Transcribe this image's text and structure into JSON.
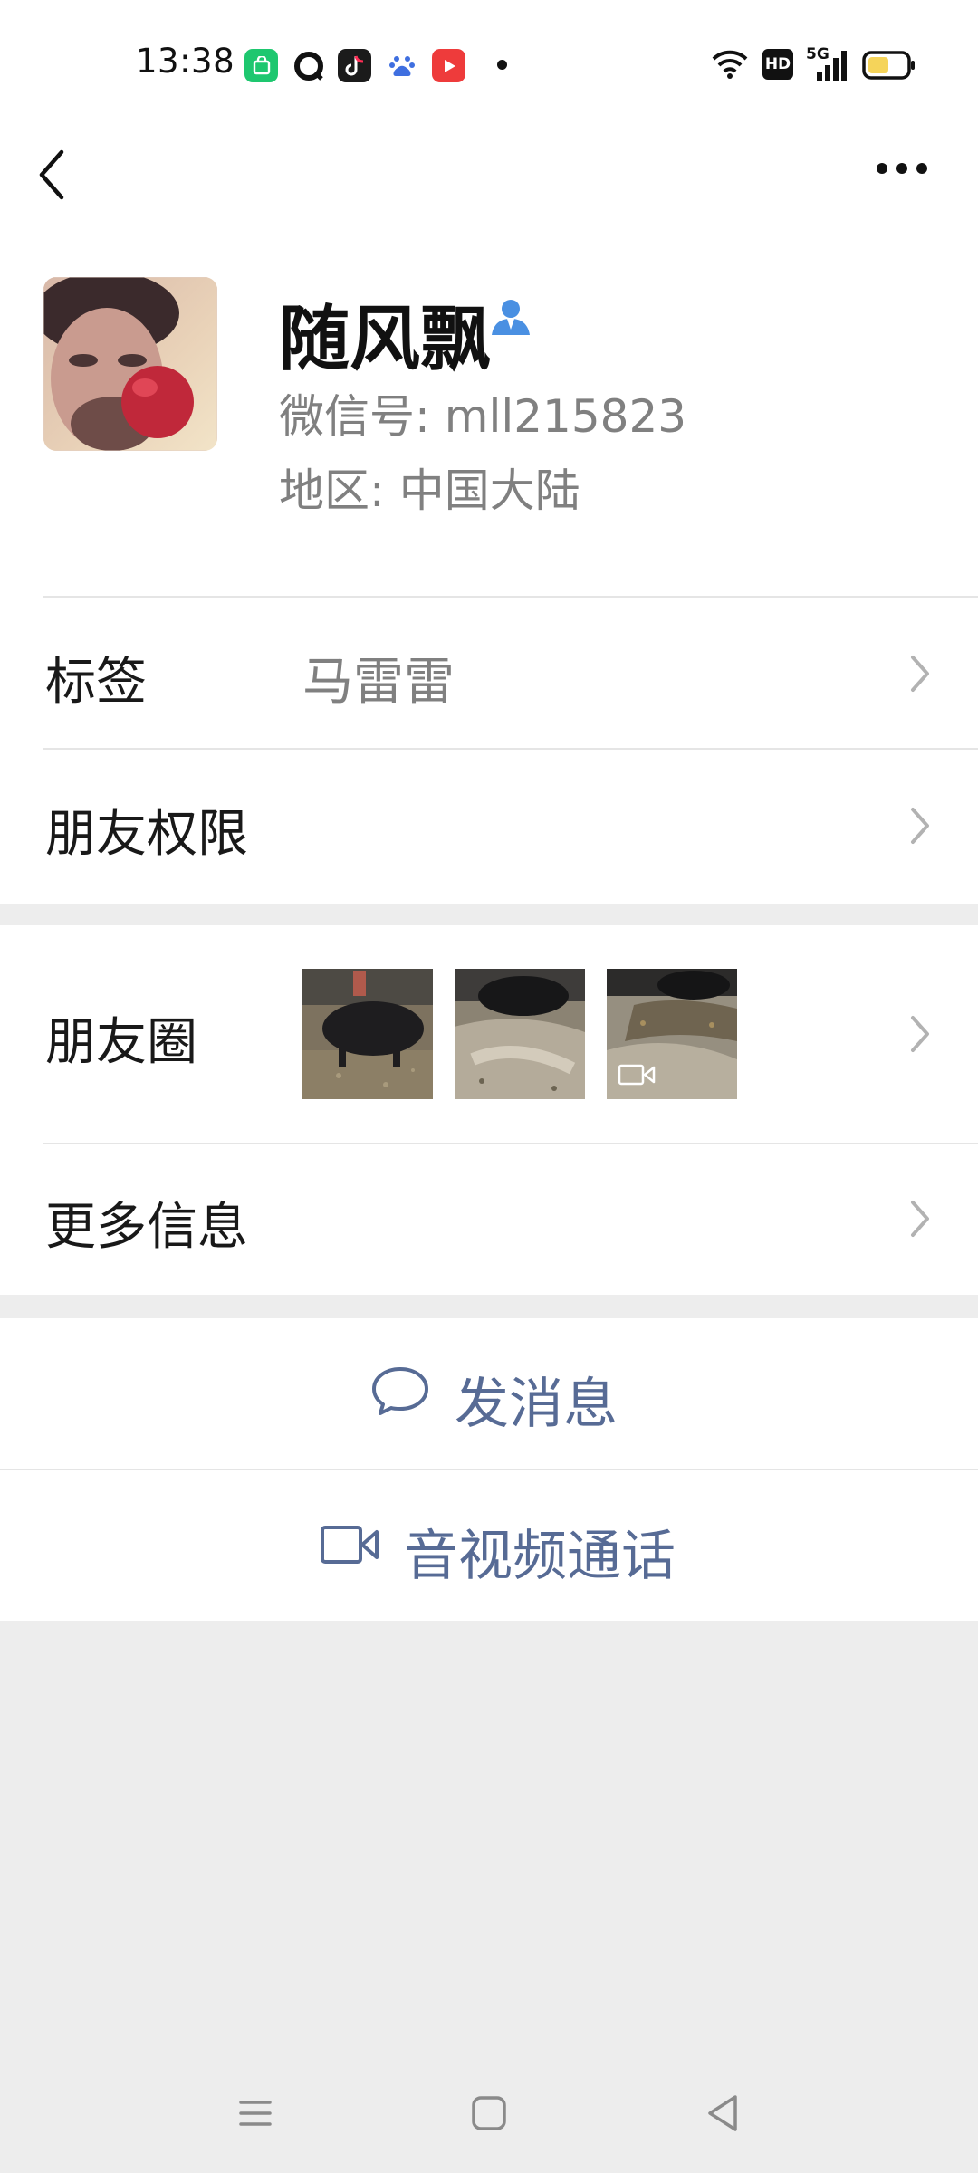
{
  "status_bar": {
    "time": "13:38",
    "signal_label": "5G",
    "hd_label": "HD"
  },
  "header": {
    "back_icon": "chevron-left-icon",
    "more_icon": "more-dots-icon"
  },
  "profile": {
    "nickname": "随风飘",
    "wechat_id": "微信号: mll215823",
    "region": "地区: 中国大陆",
    "contact_icon": "contact-person-icon"
  },
  "rows": {
    "tag_label": "标签",
    "tag_value": "马雷雷",
    "permissions_label": "朋友权限",
    "moments_label": "朋友圈",
    "more_info_label": "更多信息"
  },
  "actions": {
    "message_label": "发消息",
    "call_label": "音视频通话"
  },
  "colors": {
    "link_blue": "#576b95",
    "contact_icon_blue": "#4a90e2",
    "page_bg": "#ededed"
  }
}
